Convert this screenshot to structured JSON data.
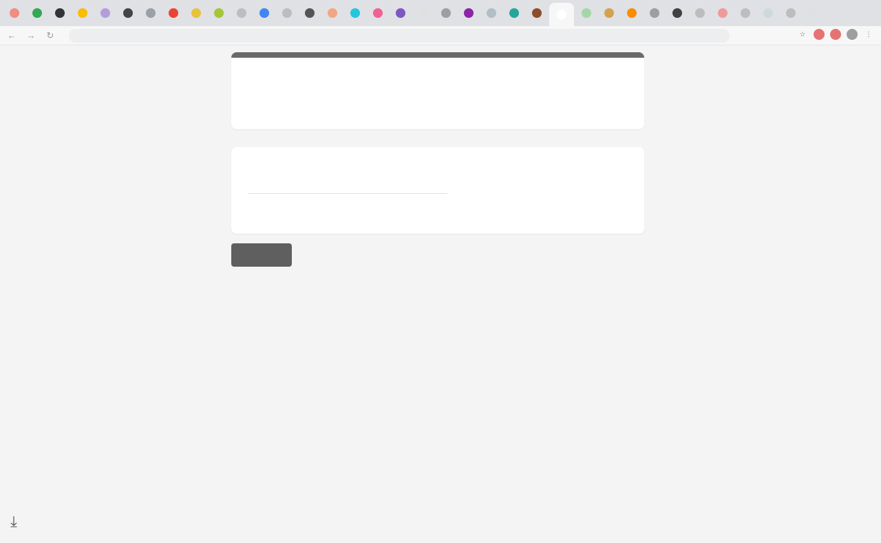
{
  "browser": {
    "tab_favicon_colors": [
      "#f28b82",
      "#34a853",
      "#333333",
      "#fbbc04",
      "#b39ddb",
      "#444444",
      "#9aa0a6",
      "#ea4335",
      "#e6c33a",
      "#a4c639",
      "#bdbdbd",
      "#4285f4",
      "#bdbdbd",
      "#555555",
      "#f4a582",
      "#26c6da",
      "#f06292",
      "#7e57c2",
      "#e0e0e0",
      "#9e9e9e",
      "#8e24aa",
      "#b0bec5",
      "#26a69a",
      "#8d4e2b",
      "#ffffff",
      "#a5d6a7",
      "#d4a24c",
      "#fb8c00",
      "#9e9e9e",
      "#424242",
      "#bdbdbd",
      "#ef9a9a",
      "#bdbdbd",
      "#cfd8dc",
      "#bdbdbd",
      "#e0e0e0"
    ],
    "active_tab_index": 24,
    "url": "",
    "icons": {
      "back": "arrow-left-icon",
      "forward": "arrow-right-icon",
      "reload": "reload-icon"
    }
  },
  "form": {
    "title": "",
    "question": {
      "text": "",
      "answer_placeholder": ""
    },
    "submit_label": "",
    "notice": "",
    "disclaimer": "",
    "brand": ""
  },
  "accent_color": "#6a6a6a"
}
